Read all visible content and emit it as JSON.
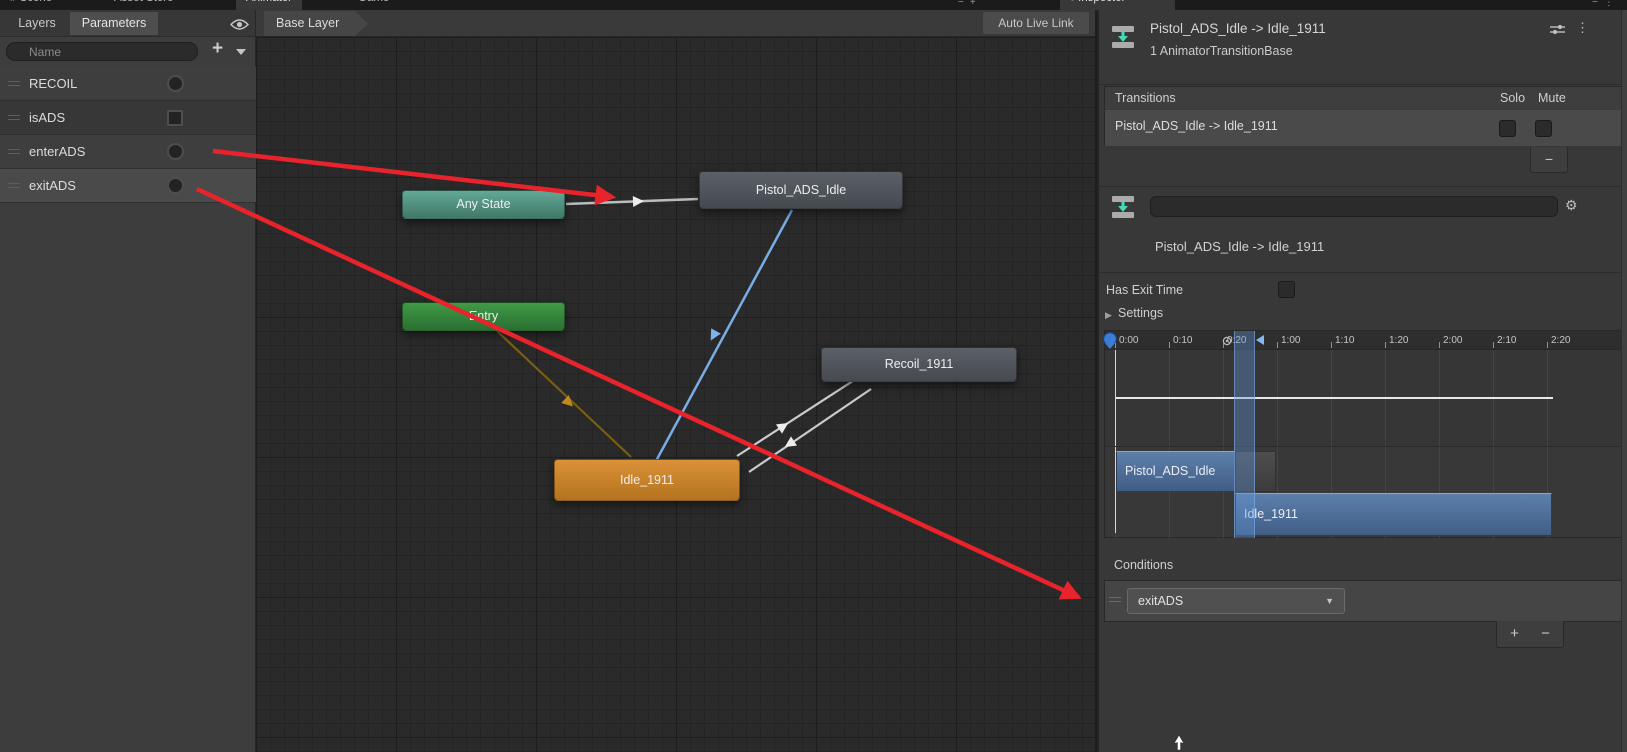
{
  "window": {
    "top_tabs": [
      {
        "label": "# Scene"
      },
      {
        "label": "Asset Store"
      },
      {
        "label": "Animator"
      },
      {
        "label": "Game"
      }
    ],
    "inspector_tab_label": "Inspector"
  },
  "icons": {
    "tab_dot": "●",
    "kebab": "⋮",
    "minus": "−",
    "plus": "+",
    "gear": "⚙",
    "caret_down": "▼",
    "foldout_right": "▶"
  },
  "parameters_panel": {
    "tabs": {
      "layers": "Layers",
      "parameters": "Parameters"
    },
    "search_placeholder": "Name",
    "add_button_label": "+",
    "rows": [
      {
        "name": "RECOIL",
        "control": "trigger",
        "selected": false
      },
      {
        "name": "isADS",
        "control": "bool",
        "selected": false
      },
      {
        "name": "enterADS",
        "control": "trigger",
        "selected": false
      },
      {
        "name": "exitADS",
        "control": "trigger",
        "selected": true
      }
    ]
  },
  "graph": {
    "breadcrumb": "Base Layer",
    "live_link_button": "Auto Live Link",
    "nodes": {
      "any_state": "Any State",
      "entry": "Entry",
      "pistol_ads_idle": "Pistol_ADS_Idle",
      "recoil_1911": "Recoil_1911",
      "idle_1911": "Idle_1911"
    }
  },
  "inspector": {
    "title": "Pistol_ADS_Idle -> Idle_1911",
    "subtitle": "1 AnimatorTransitionBase",
    "transitions_header": "Transitions",
    "solo_label": "Solo",
    "mute_label": "Mute",
    "transition_row": "Pistol_ADS_Idle -> Idle_1911",
    "remove_button": "−",
    "name_field_value": "",
    "transition_label": "Pistol_ADS_Idle -> Idle_1911",
    "has_exit_time_label": "Has Exit Time",
    "has_exit_time_checked": false,
    "settings_label": "Settings",
    "timeline": {
      "ticks": [
        "0:00",
        "0:10",
        "0:20",
        "1:00",
        "1:10",
        "1:20",
        "2:00",
        "2:10",
        "2:20"
      ],
      "blocks": {
        "source": "Pistol_ADS_Idle",
        "destination": "Idle_1911"
      }
    },
    "conditions_header": "Conditions",
    "condition_value": "exitADS",
    "add_remove": {
      "add": "+",
      "remove": "−"
    }
  },
  "colors": {
    "annotation_arrow": "#e9232b",
    "selected_transition_blue": "#7fb2e8",
    "state_orange": "#c77f28",
    "any_state_teal": "#4f9383",
    "entry_green": "#2f8636",
    "timeline_block_blue": "#53779f"
  }
}
